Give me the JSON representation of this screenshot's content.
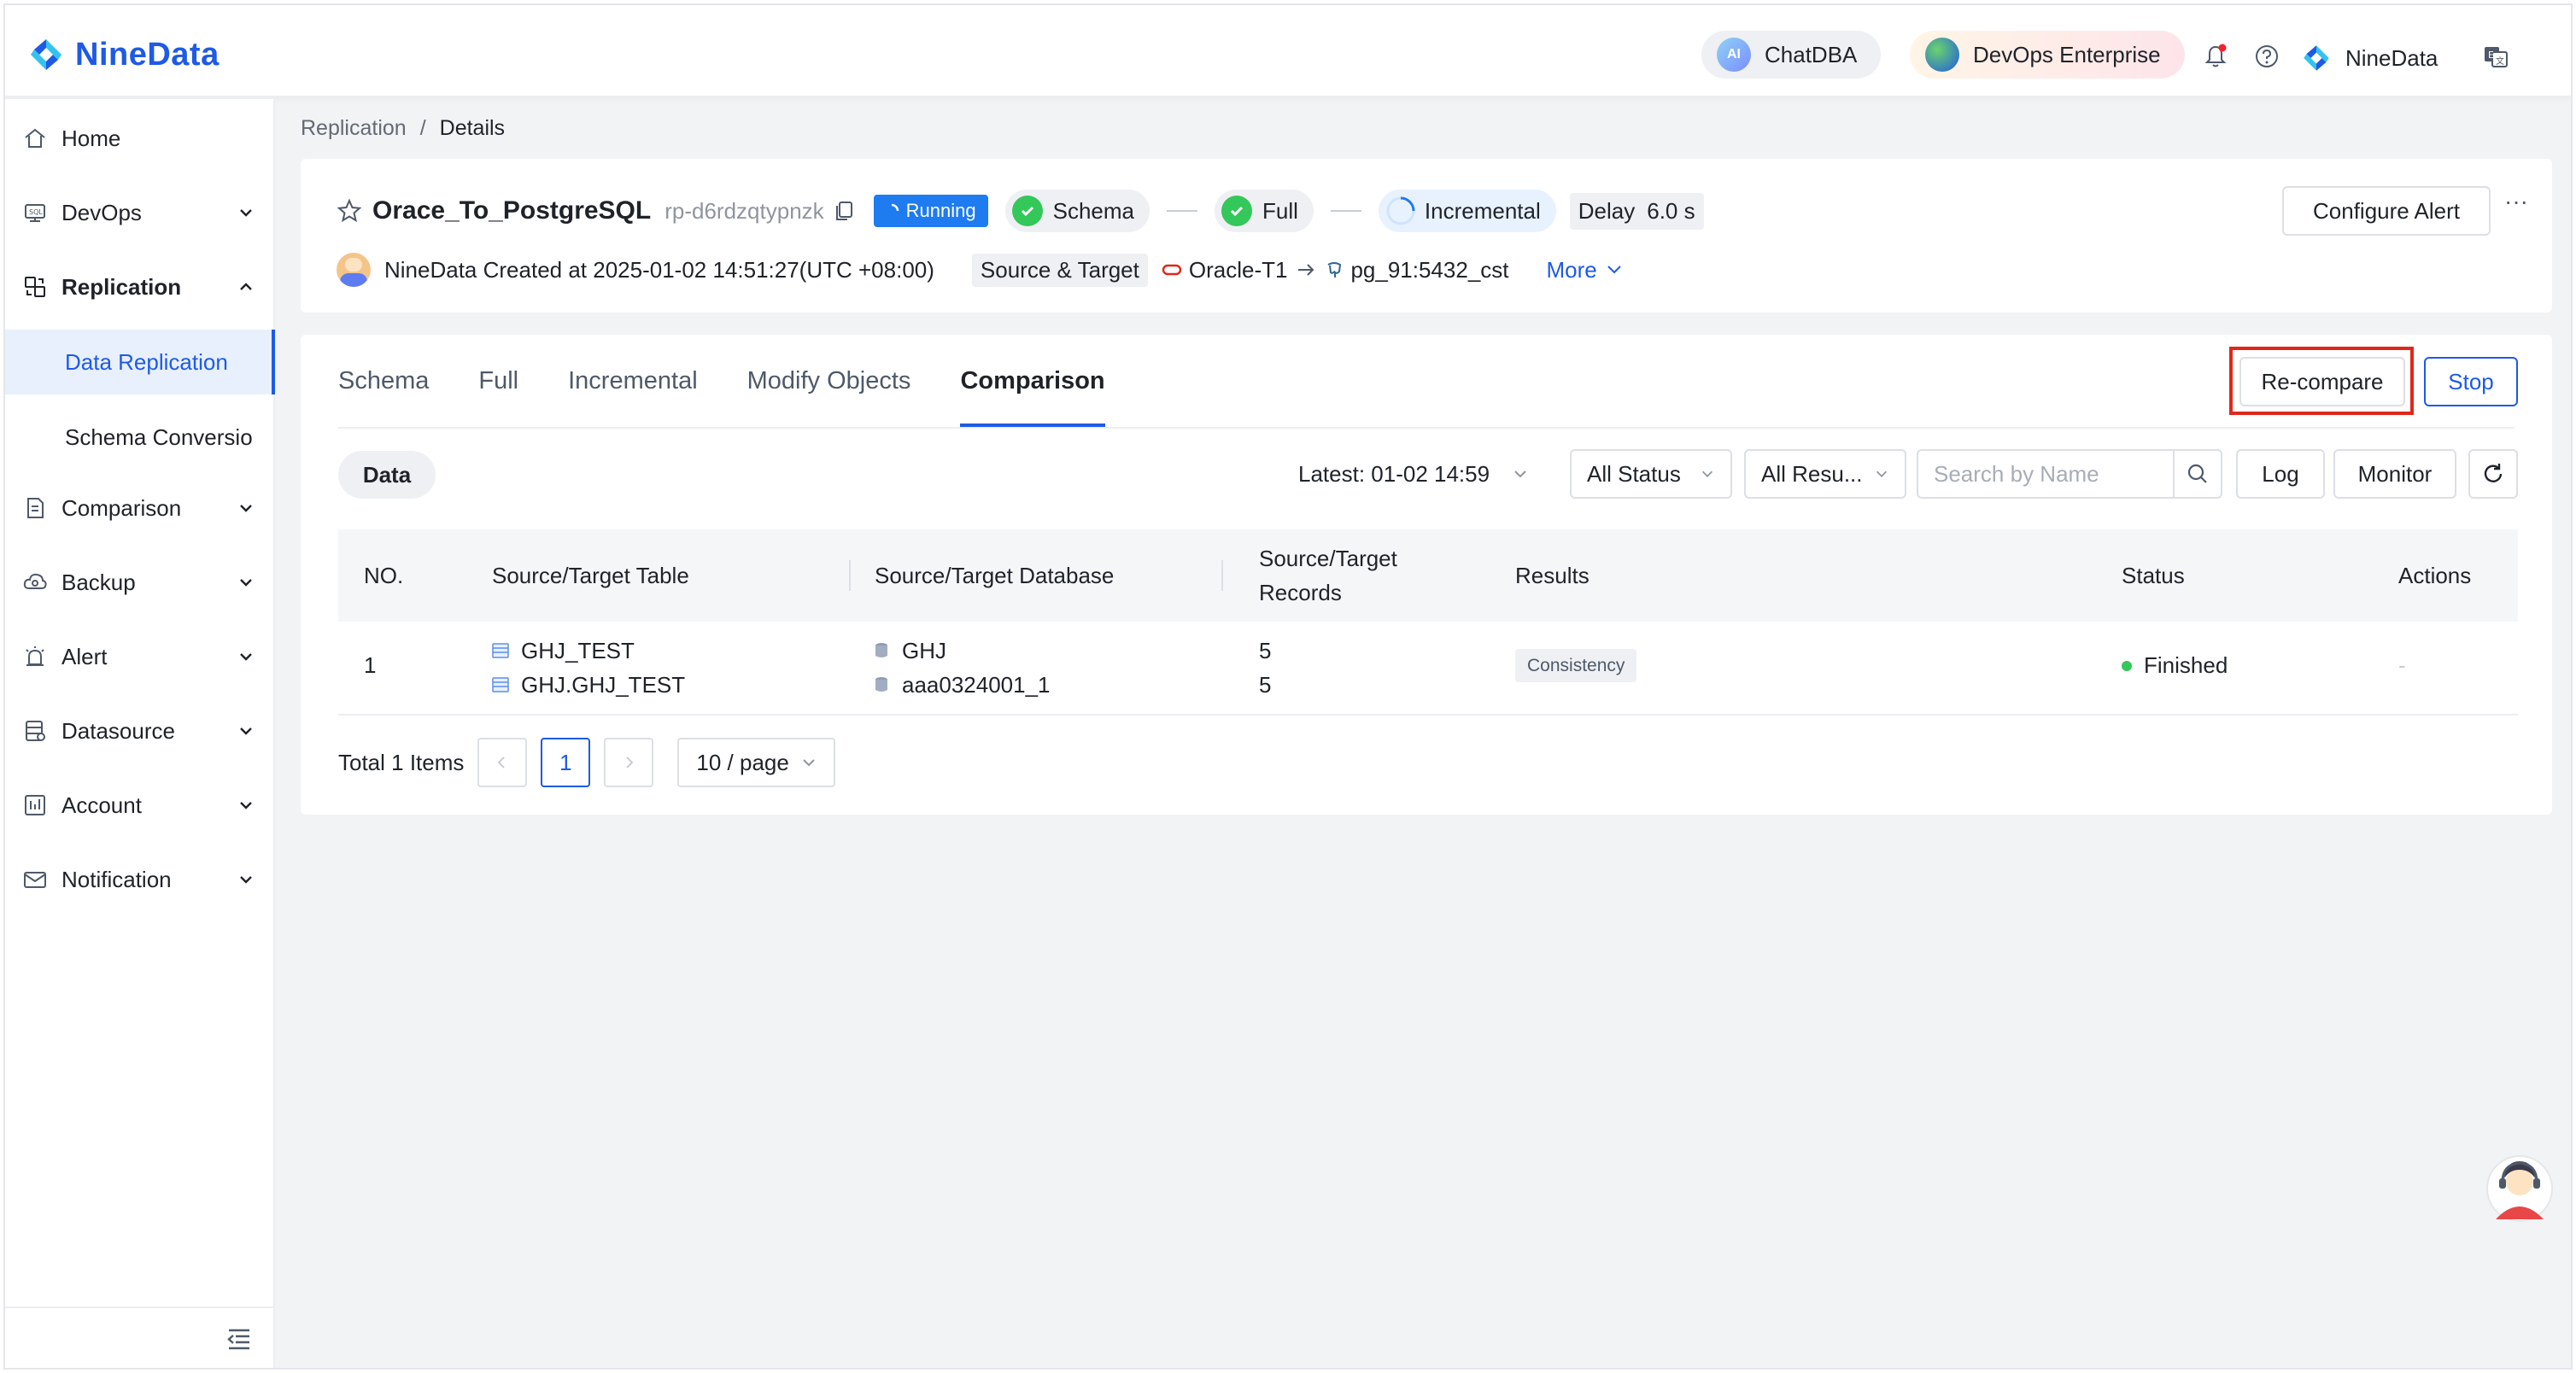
{
  "topbar": {
    "brand": "NineData",
    "chatdba_label": "ChatDBA",
    "chatdba_icon_text": "AI",
    "devops_label": "DevOps Enterprise",
    "user_name": "NineData",
    "icons": [
      "bell-icon",
      "help-icon",
      "language-icon"
    ]
  },
  "sidebar": {
    "items": [
      {
        "label": "Home",
        "icon": "home-icon"
      },
      {
        "label": "DevOps",
        "icon": "devops-icon"
      },
      {
        "label": "Replication",
        "icon": "replication-icon"
      },
      {
        "label": "Data Replication"
      },
      {
        "label": "Schema Conversio"
      },
      {
        "label": "Comparison",
        "icon": "comparison-icon"
      },
      {
        "label": "Backup",
        "icon": "backup-icon"
      },
      {
        "label": "Alert",
        "icon": "alert-icon"
      },
      {
        "label": "Datasource",
        "icon": "datasource-icon"
      },
      {
        "label": "Account",
        "icon": "account-icon"
      },
      {
        "label": "Notification",
        "icon": "mail-icon"
      }
    ]
  },
  "breadcrumb": {
    "parent": "Replication",
    "separator": "/",
    "current": "Details"
  },
  "task": {
    "name": "Orace_To_PostgreSQL",
    "id": "rp-d6rdzqtypnzk",
    "status": "Running",
    "stages": [
      "Schema",
      "Full",
      "Incremental"
    ],
    "delay_label": "Delay",
    "delay_value": "6.0 s",
    "creator_line": "NineData Created at 2025-01-02 14:51:27(UTC +08:00)",
    "source_target_label": "Source & Target",
    "source": "Oracle-T1",
    "target": "pg_91:5432_cst",
    "more_label": "More",
    "configure_alert": "Configure Alert",
    "ellipsis": "···"
  },
  "tabs": [
    "Schema",
    "Full",
    "Incremental",
    "Modify Objects",
    "Comparison"
  ],
  "active_tab": "Comparison",
  "actions": {
    "recompare": "Re-compare",
    "stop": "Stop"
  },
  "filters": {
    "data_tab": "Data",
    "latest": "Latest: 01-02 14:59",
    "status": "All Status",
    "results": "All Resu...",
    "search_placeholder": "Search by Name",
    "log": "Log",
    "monitor": "Monitor"
  },
  "table": {
    "headers": [
      "NO.",
      "Source/Target Table",
      "Source/Target Database",
      "Source/Target",
      "Records",
      "Results",
      "Status",
      "Actions"
    ],
    "rows": [
      {
        "no": "1",
        "source_table": "GHJ_TEST",
        "target_table": "GHJ.GHJ_TEST",
        "source_db": "GHJ",
        "target_db": "aaa0324001_1",
        "source_records": "5",
        "target_records": "5",
        "result": "Consistency",
        "status": "Finished",
        "actions": "-"
      }
    ]
  },
  "pagination": {
    "total": "Total 1 Items",
    "current_page": "1",
    "page_size": "10 / page"
  },
  "colors": {
    "brand": "#1e5ae6",
    "running": "#1e7bf0",
    "success": "#34c759",
    "highlight_box": "#e0271a"
  }
}
